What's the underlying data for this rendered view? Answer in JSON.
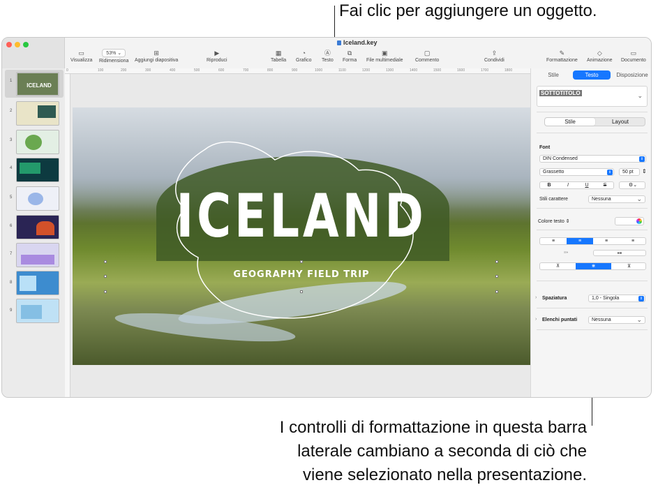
{
  "callouts": {
    "top": "Fai clic per aggiungere un oggetto.",
    "bottom_line1": "I controlli di formattazione in questa barra",
    "bottom_line2": "laterale cambiano a seconda di ciò che",
    "bottom_line3": "viene selezionato nella presentazione."
  },
  "window": {
    "title": "Iceland.key"
  },
  "toolbar": {
    "zoom_value": "53% ⌄",
    "items": {
      "visualizza": "Visualizza",
      "ridimensiona": "Ridimensiona",
      "aggiungi": "Aggiungi diapositiva",
      "riproduci": "Riproduci",
      "tabella": "Tabella",
      "grafico": "Grafico",
      "testo": "Testo",
      "forma": "Forma",
      "media": "File multimediale",
      "commento": "Commento",
      "condividi": "Condividi",
      "formattazione": "Formattazione",
      "animazione": "Animazione",
      "documento": "Documento"
    }
  },
  "ruler": [
    "0",
    "100",
    "200",
    "300",
    "400",
    "500",
    "600",
    "700",
    "800",
    "900",
    "1000",
    "1100",
    "1200",
    "1300",
    "1400",
    "1500",
    "1600",
    "1700",
    "1800"
  ],
  "navigator": {
    "slides": [
      {
        "num": "1",
        "bg": "#6b7f55",
        "label": "ICELAND"
      },
      {
        "num": "2",
        "bg": "#e9e4c8"
      },
      {
        "num": "3",
        "bg": "#e3efe4"
      },
      {
        "num": "4",
        "bg": "#0d3a40"
      },
      {
        "num": "5",
        "bg": "#eef0f7"
      },
      {
        "num": "6",
        "bg": "#2a2454"
      },
      {
        "num": "7",
        "bg": "#d9d6f0"
      },
      {
        "num": "8",
        "bg": "#3d8ccf"
      },
      {
        "num": "9",
        "bg": "#bfe1f5"
      }
    ]
  },
  "slide": {
    "title": "ICELAND",
    "subtitle": "GEOGRAPHY FIELD TRIP"
  },
  "inspector": {
    "tabs": {
      "stile": "Stile",
      "testo": "Testo",
      "disposizione": "Disposizione"
    },
    "paragraph_style": "SOTTOTITOLO",
    "segment": {
      "stile": "Stile",
      "layout": "Layout"
    },
    "font_label": "Font",
    "font_family": "DIN Condensed",
    "font_weight": "Grassetto",
    "font_size": "50 pt",
    "format_buttons": {
      "bold": "B",
      "italic": "I",
      "underline": "U",
      "strike": "S",
      "more": "⚙⌄"
    },
    "char_styles_label": "Stili carattere",
    "char_styles_value": "Nessuna",
    "text_color_label": "Colore testo ⇕",
    "spacing_label": "Spaziatura",
    "spacing_value": "1,0 - Singola",
    "bullets_label": "Elenchi puntati",
    "bullets_value": "Nessuna",
    "align_icons": [
      "≡",
      "≡",
      "≡",
      "≡"
    ],
    "indent_icons": [
      "≡•",
      "•≡"
    ],
    "valign_icons": [
      "⊼",
      "⋇",
      "⊻"
    ]
  },
  "colors": {
    "accent": "#1677ff"
  }
}
